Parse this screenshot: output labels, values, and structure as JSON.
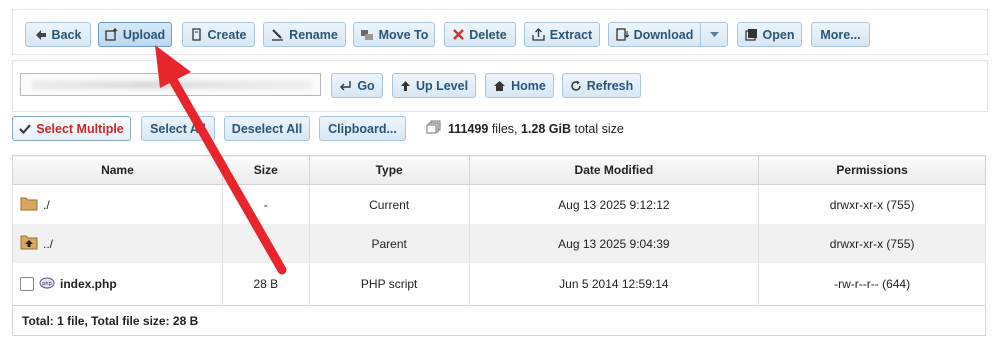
{
  "toolbar": {
    "back": "Back",
    "upload": "Upload",
    "create": "Create",
    "rename": "Rename",
    "move_to": "Move To",
    "delete": "Delete",
    "extract": "Extract",
    "download": "Download",
    "open": "Open",
    "more": "More..."
  },
  "path_bar": {
    "go": "Go",
    "up_level": "Up Level",
    "home": "Home",
    "refresh": "Refresh"
  },
  "selection": {
    "select_multiple": "Select Multiple",
    "select_all": "Select All",
    "deselect_all": "Deselect All",
    "clipboard": "Clipboard..."
  },
  "summary": {
    "files_count": "111499",
    "files_word": " files, ",
    "total_size": "1.28 GiB",
    "total_word": " total size"
  },
  "table": {
    "headers": [
      "Name",
      "Size",
      "Type",
      "Date Modified",
      "Permissions"
    ],
    "rows": [
      {
        "name": "./",
        "size": "-",
        "type": "Current",
        "date": "Aug 13 2025 9:12:12",
        "perms": "drwxr-xr-x (755)"
      },
      {
        "name": "../",
        "size": "",
        "type": "Parent",
        "date": "Aug 13 2025 9:04:39",
        "perms": "drwxr-xr-x (755)"
      },
      {
        "name": "index.php",
        "size": "28 B",
        "type": "PHP script",
        "date": "Jun 5 2014 12:59:14",
        "perms": "-rw-r--r-- (644)"
      }
    ],
    "footer": "Total: 1 file, Total file size: 28 B"
  },
  "icons": {
    "back": "back-arrow-icon",
    "upload": "upload-icon",
    "create": "create-icon",
    "rename": "rename-icon",
    "move": "move-icon",
    "delete": "delete-x-icon",
    "extract": "extract-icon",
    "download": "download-icon",
    "open": "open-icon",
    "folder": "folder-icon",
    "parent": "parent-folder-icon",
    "php": "php-file-icon"
  },
  "colors": {
    "accent_text": "#2b5576",
    "button_border": "#a9c6dc",
    "delete_red": "#c62828",
    "annotation_arrow": "#e8252b"
  }
}
